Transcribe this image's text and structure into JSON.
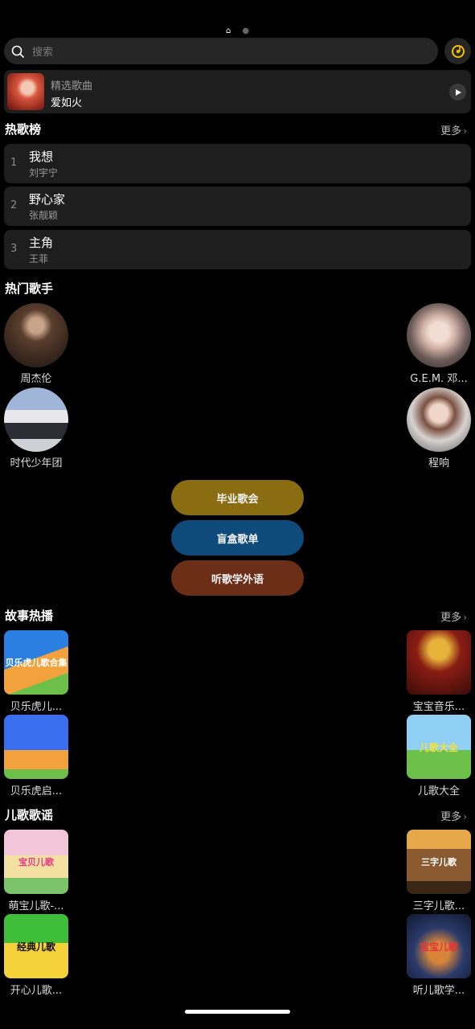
{
  "search": {
    "placeholder": "搜索"
  },
  "featured": {
    "label": "精选歌曲",
    "song": "爱如火"
  },
  "hot_chart": {
    "title": "热歌榜",
    "more": "更多",
    "items": [
      {
        "rank": "1",
        "title": "我想",
        "artist": "刘宇宁"
      },
      {
        "rank": "2",
        "title": "野心家",
        "artist": "张靓颖"
      },
      {
        "rank": "3",
        "title": "主角",
        "artist": "王菲"
      }
    ]
  },
  "hot_artists": {
    "title": "热门歌手",
    "items": [
      {
        "name": "周杰伦"
      },
      {
        "name": "G.E.M. 邓..."
      },
      {
        "name": "时代少年团"
      },
      {
        "name": "程响"
      }
    ]
  },
  "playlists": [
    {
      "label": "毕业歌会",
      "color": "#8a6d10"
    },
    {
      "label": "盲盒歌单",
      "color": "#0e4a7a"
    },
    {
      "label": "听歌学外语",
      "color": "#6b2e16"
    }
  ],
  "stories": {
    "title": "故事热播",
    "more": "更多",
    "items": [
      {
        "name": "贝乐虎儿...",
        "cover_text": "贝乐虎儿歌合集"
      },
      {
        "name": "宝宝音乐..."
      },
      {
        "name": "贝乐虎启..."
      },
      {
        "name": "儿歌大全",
        "cover_text": "儿歌大全"
      }
    ]
  },
  "kids_songs": {
    "title": "儿歌歌谣",
    "more": "更多",
    "items": [
      {
        "name": "萌宝儿歌-...",
        "cover_text": "宝贝儿歌"
      },
      {
        "name": "三字儿歌...",
        "cover_text": "三字儿歌"
      },
      {
        "name": "开心儿歌...",
        "cover_text": "经典儿歌"
      },
      {
        "name": "听儿歌学...",
        "cover_text": "宝宝儿歌"
      }
    ]
  }
}
